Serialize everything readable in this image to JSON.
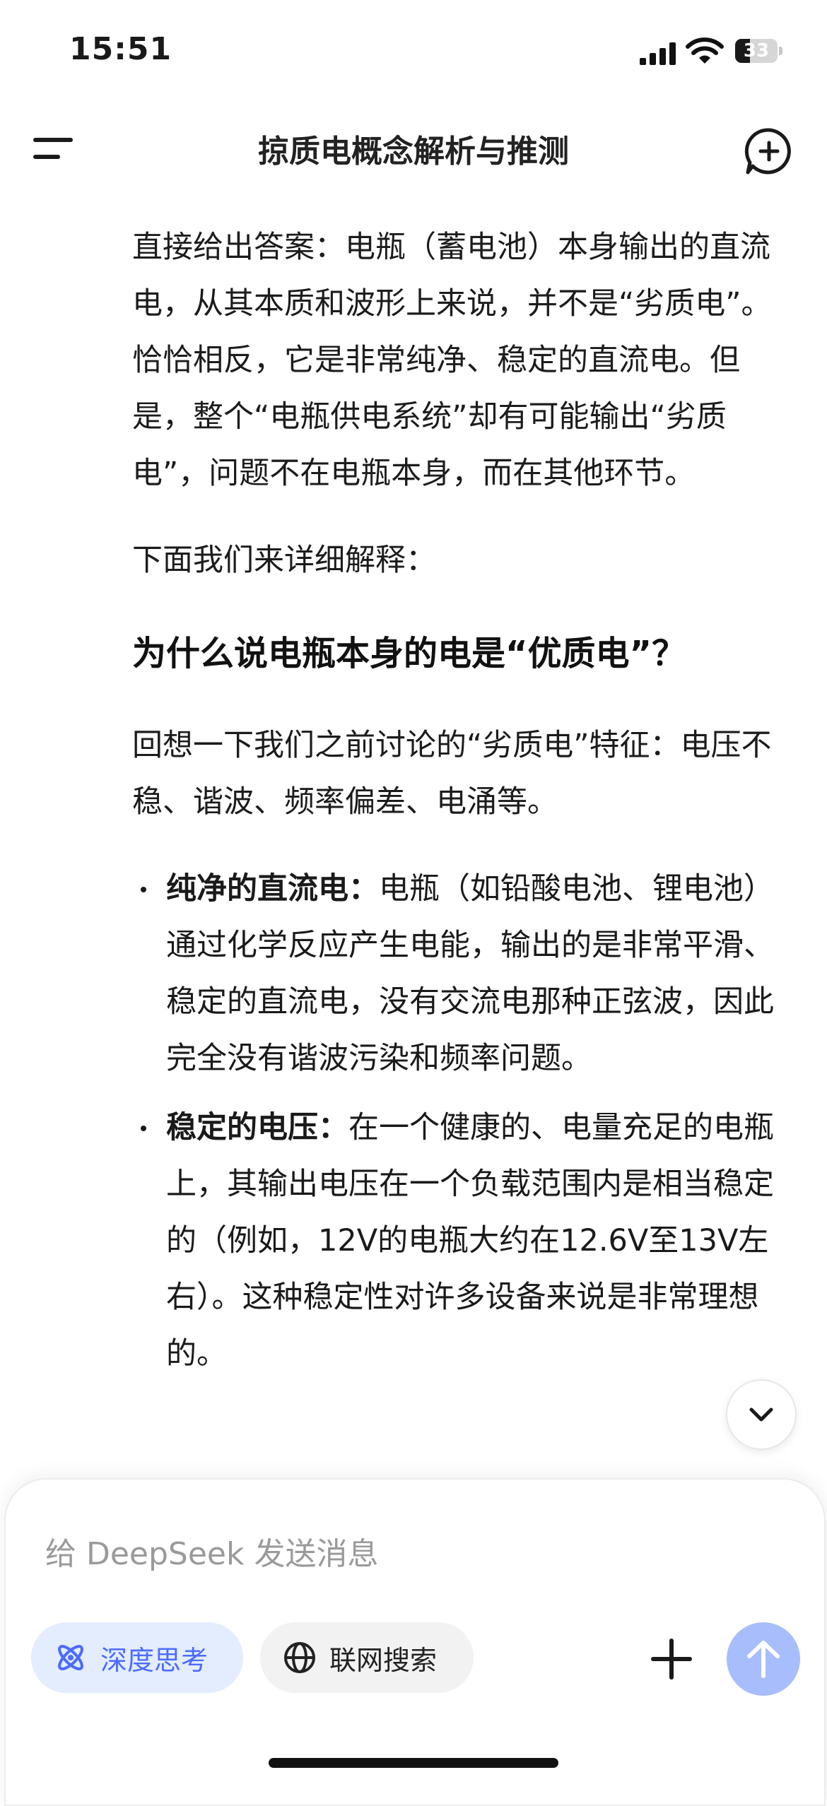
{
  "status_bar": {
    "time": "15:51",
    "battery_percent": "33"
  },
  "nav": {
    "title": "掠质电概念解析与推测"
  },
  "content": {
    "intro": "直接给出答案：电瓶（蓄电池）本身输出的直流电，从其本质和波形上来说，并不是“劣质电”。恰恰相反，它是非常纯净、稳定的直流电。但是，整个“电瓶供电系统”却有可能输出“劣质电”，问题不在电瓶本身，而在其他环节。",
    "lead": "下面我们来详细解释：",
    "heading": "为什么说电瓶本身的电是“优质电”？",
    "recall": "回想一下我们之前讨论的“劣质电”特征：电压不稳、谐波、频率偏差、电涌等。",
    "points": [
      {
        "title": "纯净的直流电：",
        "body": "电瓶（如铅酸电池、锂电池）通过化学反应产生电能，输出的是非常平滑、稳定的直流电，没有交流电那种正弦波，因此完全没有谐波污染和频率问题。"
      },
      {
        "title": "稳定的电压：",
        "body": "在一个健康的、电量充足的电瓶上，其输出电压在一个负载范围内是相当稳定的（例如，12V的电瓶大约在12.6V至13V左右）。这种稳定性对许多设备来说是非常理想的。"
      }
    ]
  },
  "composer": {
    "placeholder": "给 DeepSeek 发送消息",
    "deep_think_label": "深度思考",
    "web_search_label": "联网搜索"
  },
  "colors": {
    "accent": "#4d6bfe",
    "accent_bg": "#e3edfe",
    "send_disabled": "#a8bdfb"
  },
  "icons": [
    "menu-icon",
    "new-chat-icon",
    "chevron-down-icon",
    "atom-icon",
    "globe-icon",
    "plus-icon",
    "arrow-up-icon"
  ]
}
